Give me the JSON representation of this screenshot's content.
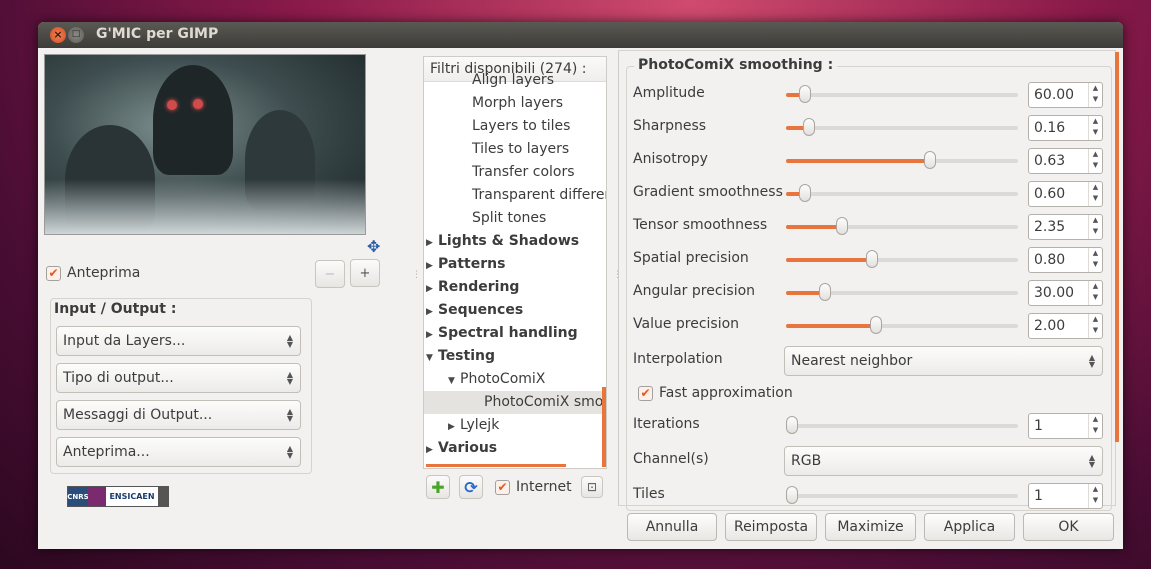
{
  "window": {
    "title": "G'MIC per GIMP",
    "close_glyph": "×",
    "min_glyph": "□"
  },
  "preview": {
    "enabled_label": "Anteprima",
    "enabled": true,
    "zoom_out_glyph": "−",
    "zoom_in_glyph": "+",
    "move_glyph": "✥"
  },
  "io": {
    "title": "Input / Output :",
    "combos": [
      "Input da Layers...",
      "Tipo di output...",
      "Messaggi di Output...",
      "Anteprima..."
    ]
  },
  "logo": {
    "text": "ENSICAEN",
    "badge": "CNRS"
  },
  "filters": {
    "header": "Filtri disponibili (274) :",
    "items": [
      {
        "label": "Align layers",
        "level": 1
      },
      {
        "label": "Morph layers",
        "level": 1
      },
      {
        "label": "Layers to tiles",
        "level": 1
      },
      {
        "label": "Tiles to layers",
        "level": 1
      },
      {
        "label": "Transfer colors",
        "level": 1
      },
      {
        "label": "Transparent difference",
        "level": 1
      },
      {
        "label": "Split tones",
        "level": 1
      },
      {
        "label": "Lights & Shadows",
        "level": 0,
        "arrow": "▶"
      },
      {
        "label": "Patterns",
        "level": 0,
        "arrow": "▶"
      },
      {
        "label": "Rendering",
        "level": 0,
        "arrow": "▶"
      },
      {
        "label": "Sequences",
        "level": 0,
        "arrow": "▶"
      },
      {
        "label": "Spectral handling",
        "level": 0,
        "arrow": "▶"
      },
      {
        "label": "Testing",
        "level": 0,
        "arrow": "▼"
      },
      {
        "label": "PhotoComiX",
        "level": 1,
        "arrow": "▼"
      },
      {
        "label": "PhotoComiX smoothing",
        "level": 2,
        "selected": true
      },
      {
        "label": "Lylejk",
        "level": 1,
        "arrow": "▶"
      },
      {
        "label": "Various",
        "level": 0,
        "arrow": "▶"
      }
    ],
    "add_glyph": "✚",
    "refresh_glyph": "⟳",
    "internet_label": "Internet",
    "internet_checked": true,
    "expand_glyph": "⊡"
  },
  "params": {
    "title": "PhotoComiX smoothing :",
    "sliders": [
      {
        "label": "Amplitude",
        "value": "60.00",
        "fraction": 0.08
      },
      {
        "label": "Sharpness",
        "value": "0.16",
        "fraction": 0.1
      },
      {
        "label": "Anisotropy",
        "value": "0.63",
        "fraction": 0.62
      },
      {
        "label": "Gradient smoothness",
        "value": "0.60",
        "fraction": 0.08
      },
      {
        "label": "Tensor smoothness",
        "value": "2.35",
        "fraction": 0.24
      },
      {
        "label": "Spatial precision",
        "value": "0.80",
        "fraction": 0.37
      },
      {
        "label": "Angular precision",
        "value": "30.00",
        "fraction": 0.17
      },
      {
        "label": "Value precision",
        "value": "2.00",
        "fraction": 0.39
      }
    ],
    "interpolation": {
      "label": "Interpolation",
      "value": "Nearest neighbor"
    },
    "fast_approx": {
      "label": "Fast approximation",
      "checked": true
    },
    "iterations": {
      "label": "Iterations",
      "value": "1",
      "fraction": 0.0
    },
    "channels": {
      "label": "Channel(s)",
      "value": "RGB"
    },
    "tiles": {
      "label": "Tiles",
      "value": "1",
      "fraction": 0.0
    }
  },
  "buttons": [
    "Annulla",
    "Reimposta",
    "Maximize",
    "Applica",
    "OK"
  ],
  "colors": {
    "accent": "#e8743e",
    "window_bg": "#f2f1f0",
    "titlebar": "#3d3c38"
  }
}
